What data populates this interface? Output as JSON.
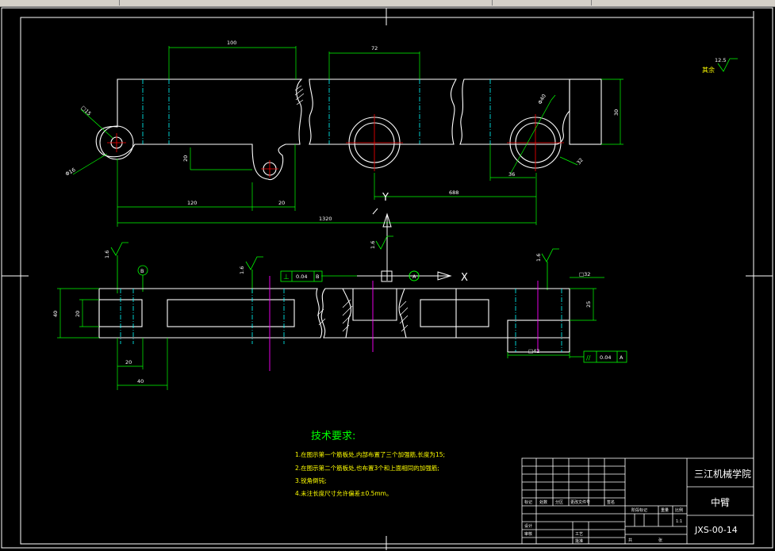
{
  "colors": {
    "background": "#000000",
    "outline": "#ffffff",
    "dimension": "#00ff00",
    "centerline": "#00ffff",
    "axis_red": "#ff0000",
    "axis_magenta": "#ff00ff",
    "note_yellow": "#ffff00",
    "tech_title_green": "#00ff00"
  },
  "top_view": {
    "dims": {
      "d100": "100",
      "d72": "72",
      "d30": "30",
      "d20a": "20",
      "d120": "120",
      "d20b": "20",
      "d1320": "1320",
      "d688": "688",
      "d36": "36",
      "sq15": "□15",
      "phi16": "Φ16",
      "phi40": "Φ40",
      "d32": "32"
    }
  },
  "roughness": {
    "corner_value": "12.5",
    "corner_label": "其余",
    "r1": "1.6",
    "r2": "1.6",
    "r3": "1.6",
    "r4": "1.6"
  },
  "axes": {
    "y_label": "Y",
    "x_label": "X",
    "datum_b": "B",
    "datum_a": "A"
  },
  "front_view": {
    "dims": {
      "d40": "40",
      "d20": "20",
      "d20b": "20",
      "d40b": "40",
      "d25": "25",
      "sq42": "□42",
      "sq32": "□32"
    },
    "tol_perp": {
      "symbol": "⊥",
      "value": "0.04",
      "datum": "B"
    },
    "tol_par": {
      "symbol": "//",
      "value": "0.04",
      "datum": "A"
    }
  },
  "tech_requirements": {
    "title": "技术要求:",
    "items": [
      "1.在图示第一个筋板处,内部布置了三个加强筋,长度为15;",
      "2.在图示第二个筋板处,也布置3个和上面相同的加强筋;",
      "3.锐角倒钝;",
      "4.未注长度尺寸允许偏差±0.5mm。"
    ]
  },
  "title_block": {
    "school": "三江机械学院",
    "part_name": "中臂",
    "drawing_no": "JXS-00-14",
    "scale": "1:1",
    "cells": {
      "c1": "标记",
      "c2": "处数",
      "c3": "分区",
      "c4": "更改文件号",
      "c5": "签名",
      "c6": "阶段标记",
      "c7": "重量",
      "c8": "比例",
      "c9": "设计",
      "c10": "审核",
      "c11": "工艺",
      "c12": "批准",
      "c13": "共",
      "c14": "张"
    }
  }
}
